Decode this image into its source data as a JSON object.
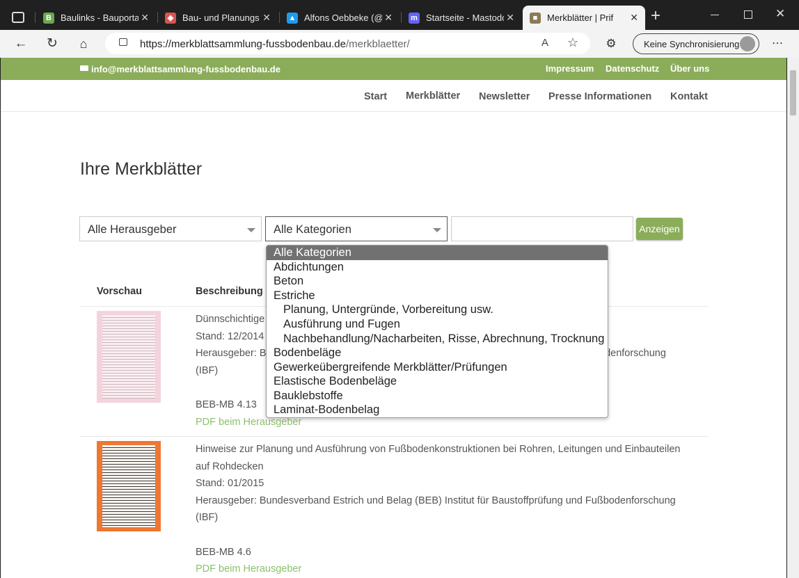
{
  "browser": {
    "tabs": [
      {
        "title": "Baulinks - Bauporta",
        "fav_color": "#6aa84f",
        "fav_letter": "B"
      },
      {
        "title": "Bau- und Planungs",
        "fav_color": "#d9534f",
        "fav_letter": "◆"
      },
      {
        "title": "Alfons Oebbeke (@",
        "fav_color": "#1d9bf0",
        "fav_letter": "▲"
      },
      {
        "title": "Startseite - Mastodo",
        "fav_color": "#6364ff",
        "fav_letter": "m"
      },
      {
        "title": "Merkblätter | Prif",
        "fav_color": "#8a7a55",
        "fav_letter": "■"
      }
    ],
    "url_domain": "https://merkblattsammlung-fussbodenbau.de",
    "url_path": "/merkblaetter/",
    "sync_label": "Keine Synchronisierung"
  },
  "site": {
    "email": "info@merkblattsammlung-fussbodenbau.de",
    "top_links": [
      "Impressum",
      "Datenschutz",
      "Über uns"
    ],
    "nav": [
      "Start",
      "Merkblätter",
      "Newsletter",
      "Presse Informationen",
      "Kontakt"
    ],
    "accent": "#8bad5a"
  },
  "main": {
    "title": "Ihre Merkblätter",
    "filter": {
      "publisher_value": "Alle Herausgeber",
      "category_value": "Alle Kategorien",
      "search_value": "",
      "show_button": "Anzeigen"
    },
    "table_headers": [
      "Vorschau",
      "Beschreibung"
    ],
    "rows": [
      {
        "desc": "Dünnschichtige",
        "stand": "Stand: 12/2014",
        "publisher": "Herausgeber: B",
        "publisher_tail": "odenforschung",
        "publisher_end": "(IBF)",
        "code": "BEB-MB 4.13",
        "pdf": "PDF beim Herausgeber"
      },
      {
        "desc": "Hinweise zur Planung und Ausführung von Fußbodenkonstruktionen bei Rohren, Leitungen und Einbauteilen auf Rohdecken",
        "stand": "Stand: 01/2015",
        "publisher": "Herausgeber: Bundesverband Estrich und Belag (BEB) Institut für Baustoffprüfung und Fußbodenforschung (IBF)",
        "code": "BEB-MB 4.6",
        "pdf": "PDF beim Herausgeber"
      }
    ]
  },
  "dropdown": {
    "options": [
      {
        "label": "Alle Kategorien",
        "selected": true,
        "indent": false
      },
      {
        "label": "Abdichtungen",
        "selected": false,
        "indent": false
      },
      {
        "label": "Beton",
        "selected": false,
        "indent": false
      },
      {
        "label": "Estriche",
        "selected": false,
        "indent": false
      },
      {
        "label": "Planung, Untergründe, Vorbereitung usw.",
        "selected": false,
        "indent": true
      },
      {
        "label": "Ausführung und Fugen",
        "selected": false,
        "indent": true
      },
      {
        "label": "Nachbehandlung/Nacharbeiten, Risse, Abrechnung, Trocknung",
        "selected": false,
        "indent": true
      },
      {
        "label": "Bodenbeläge",
        "selected": false,
        "indent": false
      },
      {
        "label": "Gewerkeübergreifende Merkblätter/Prüfungen",
        "selected": false,
        "indent": false
      },
      {
        "label": "Elastische Bodenbeläge",
        "selected": false,
        "indent": false
      },
      {
        "label": "Bauklebstoffe",
        "selected": false,
        "indent": false
      },
      {
        "label": "Laminat-Bodenbelag",
        "selected": false,
        "indent": false
      }
    ]
  }
}
